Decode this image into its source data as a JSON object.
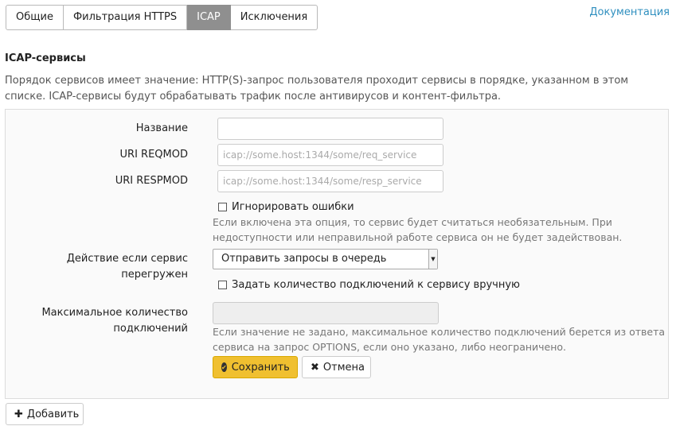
{
  "tabs": [
    {
      "label": "Общие"
    },
    {
      "label": "Фильтрация HTTPS"
    },
    {
      "label": "ICAP",
      "active": true
    },
    {
      "label": "Исключения"
    }
  ],
  "doc_link": "Документация",
  "section": {
    "title": "ICAP-сервисы",
    "description": "Порядок сервисов имеет значение: HTTP(S)-запрос пользователя проходит сервисы в порядке, указанном в этом списке. ICAP-сервисы будут обрабатывать трафик после антивирусов и контент-фильтра."
  },
  "form": {
    "name_label": "Название",
    "name_value": "",
    "reqmod_label": "URI REQMOD",
    "reqmod_placeholder": "icap://some.host:1344/some/req_service",
    "respmod_label": "URI RESPMOD",
    "respmod_placeholder": "icap://some.host:1344/some/resp_service",
    "ignore_errors_label": "Игнорировать ошибки",
    "ignore_errors_checked": false,
    "ignore_errors_help": "Если включена эта опция, то сервис будет считаться необязательным. При недоступности или неправильной работе сервиса он не будет задействован.",
    "overload_label": "Действие если сервис перегружен",
    "overload_value": "Отправить запросы в очередь",
    "manual_conn_label": "Задать количество подключений к сервису вручную",
    "manual_conn_checked": false,
    "max_conn_label": "Максимальное количество подключений",
    "max_conn_value": "",
    "max_conn_help": "Если значение не задано, максимальное количество подключений берется из ответа сервиса на запрос OPTIONS, если оно указано, либо неограничено.",
    "save_label": "Сохранить",
    "cancel_label": "Отмена"
  },
  "add_label": "Добавить",
  "colors": {
    "accent": "#f0c030",
    "link": "#2f8fbf",
    "active_tab": "#8f8f8f"
  },
  "icons": {
    "save": "check-circle-icon",
    "cancel": "close-icon",
    "add": "plus-icon",
    "select": "caret-down-icon"
  }
}
